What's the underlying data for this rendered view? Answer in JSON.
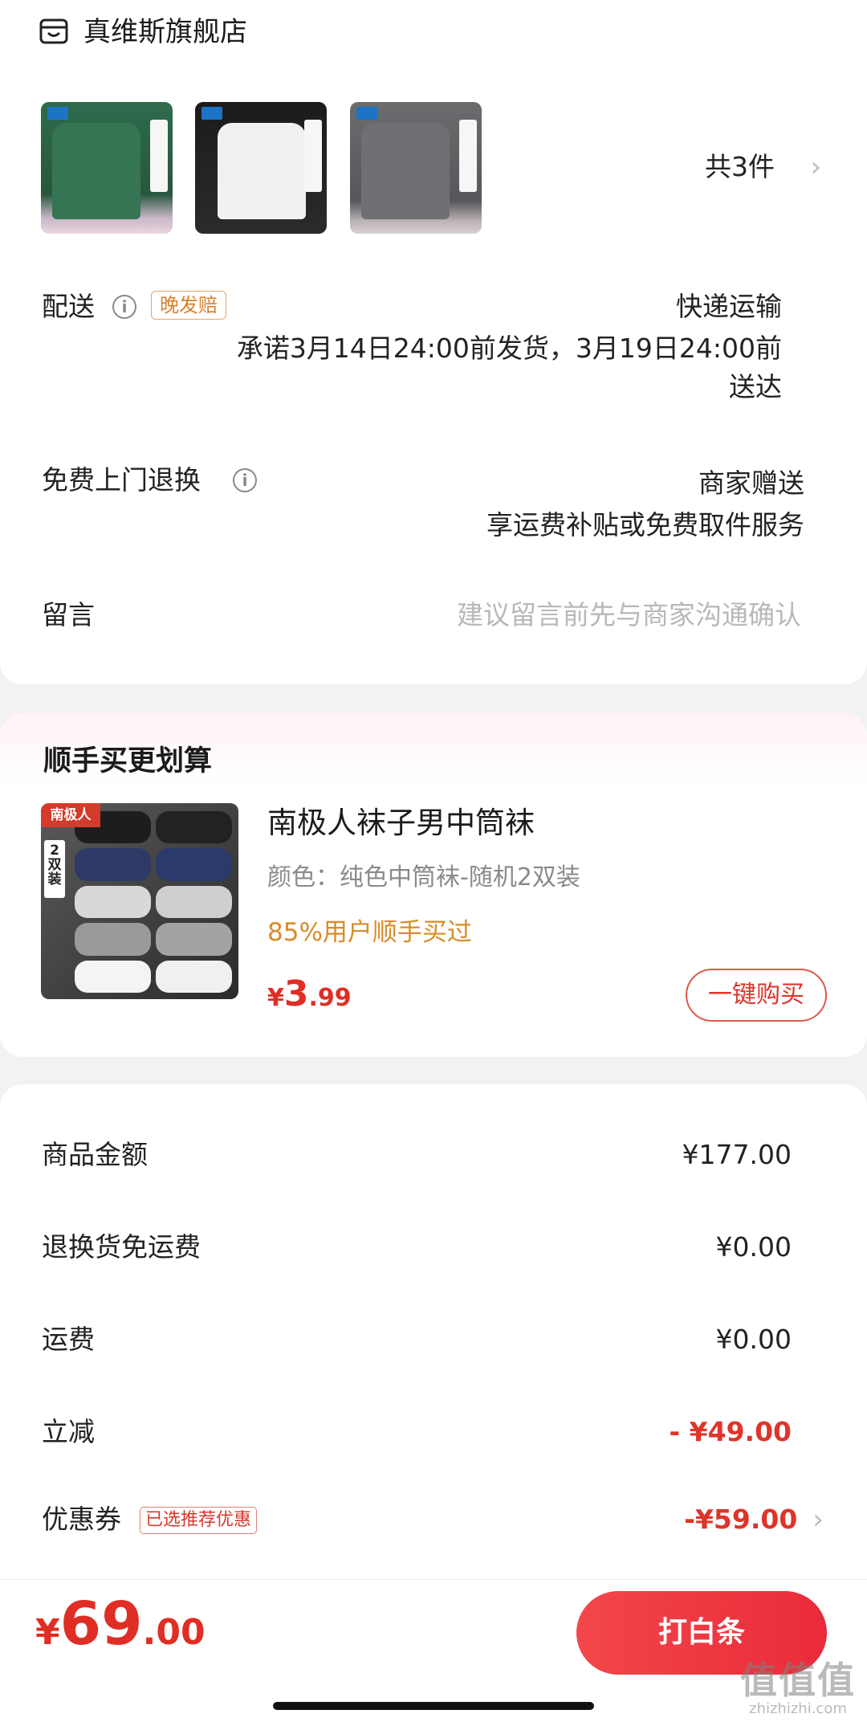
{
  "store": {
    "icon": "store-icon",
    "name": "真维斯旗舰店"
  },
  "order": {
    "thumbnails": [
      "green-tshirt-image",
      "white-tshirt-image",
      "grey-tshirt-image"
    ],
    "item_count": "共3件"
  },
  "delivery": {
    "label": "配送",
    "badge": "晚发赔",
    "method": "快递运输",
    "promise_line1": "承诺3月14日24:00前发货，3月19日24:00前",
    "promise_line2": "送达"
  },
  "return_service": {
    "label": "免费上门退换",
    "value": "商家赠送",
    "desc": "享运费补贴或免费取件服务"
  },
  "message": {
    "label": "留言",
    "placeholder": "建议留言前先与商家沟通确认"
  },
  "bundle": {
    "title": "顺手买更划算",
    "image_brand": "南极人",
    "image_badge": "2双装",
    "product_name": "南极人袜子男中筒袜",
    "spec": "颜色：纯色中筒袜-随机2双装",
    "note": "85%用户顺手买过",
    "price_currency": "¥",
    "price_int": "3",
    "price_dec": ".99",
    "buy_button": "一键购买"
  },
  "price_rows": [
    {
      "label": "商品金额",
      "value": "¥177.00"
    },
    {
      "label": "退换货免运费",
      "value": "¥0.00"
    },
    {
      "label": "运费",
      "value": "¥0.00"
    },
    {
      "label": "立减",
      "value": "- ¥49.00"
    },
    {
      "label": "优惠券",
      "badge": "已选推荐优惠",
      "value": "-¥59.00"
    }
  ],
  "bottom_bar": {
    "currency": "¥",
    "total_int": "69",
    "total_dec": ".00",
    "pay_button": "打白条",
    "watermark": "值值值",
    "watermark_sub": "zhizhizhi.com"
  },
  "colors": {
    "accent_red": "#e02e24",
    "orange": "#d9822b"
  }
}
